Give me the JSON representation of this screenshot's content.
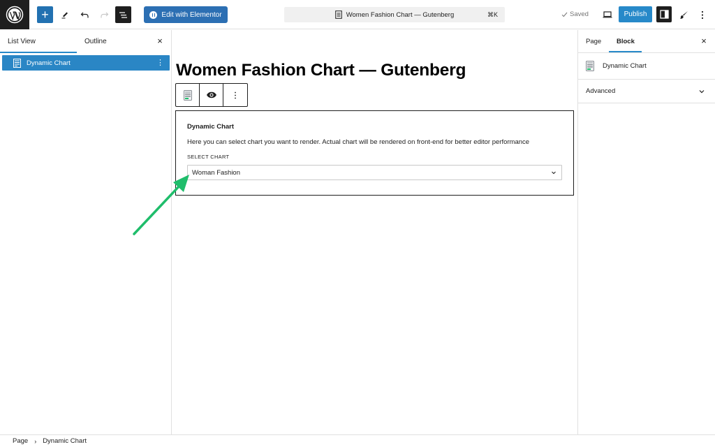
{
  "topbar": {
    "logo_icon": "wordpress-logo-icon",
    "add_block_icon": "plus-icon",
    "tools_icon": "pen-icon",
    "undo_icon": "undo-icon",
    "redo_icon": "redo-icon",
    "document_overview_icon": "list-view-icon",
    "elementor_button_label": "Edit with Elementor",
    "command_bar": {
      "title": "Women Fashion Chart — Gutenberg",
      "shortcut": "⌘K"
    },
    "saved_label": "Saved",
    "preview_icon": "laptop-icon",
    "publish_label": "Publish",
    "settings_icon": "sidebar-toggle-icon",
    "styles_icon": "brush-icon",
    "options_icon": "kebab-vertical-icon"
  },
  "left_panel": {
    "tabs": [
      {
        "label": "List View",
        "active": true
      },
      {
        "label": "Outline",
        "active": false
      }
    ],
    "close_label": "×",
    "items": [
      {
        "label": "Dynamic Chart",
        "selected": true,
        "menu": "⋮"
      }
    ]
  },
  "canvas": {
    "post_title": "Women Fashion Chart — Gutenberg",
    "block_toolbar": {
      "block_type_icon": "chart-block-icon",
      "preview_icon": "eye-icon",
      "options": "⋮"
    },
    "chart_block": {
      "title": "Dynamic Chart",
      "description": "Here you can select chart you want to render. Actual chart will be rendered on front-end for better editor performance",
      "select_label": "SELECT CHART",
      "select_value": "Woman Fashion"
    },
    "annotation": {
      "type": "arrow",
      "color": "#1fbd6b"
    }
  },
  "right_panel": {
    "tabs": [
      {
        "label": "Page",
        "active": false
      },
      {
        "label": "Block",
        "active": true
      }
    ],
    "close_label": "×",
    "block_name": "Dynamic Chart",
    "sections": [
      {
        "label": "Advanced",
        "expanded": false
      }
    ]
  },
  "footer": {
    "breadcrumb": [
      "Page",
      "Dynamic Chart"
    ],
    "separator": "›"
  },
  "colors": {
    "accent": "#2789c9",
    "elementor": "#2c6fb3",
    "dark": "#1e1e1e",
    "annotation_arrow": "#1fbd6b"
  }
}
